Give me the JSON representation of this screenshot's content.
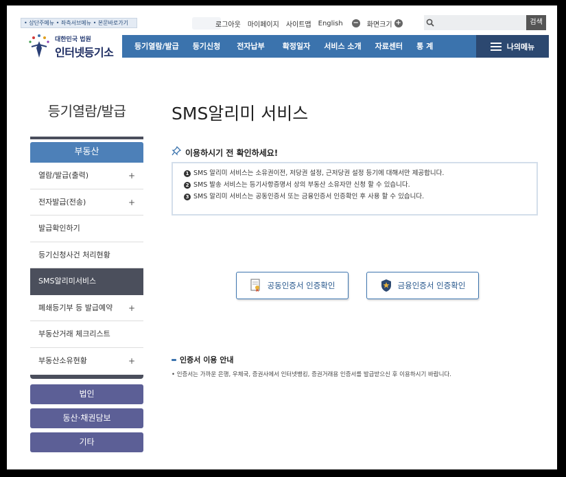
{
  "header": {
    "skip_links": "• 상단주메뉴 • 좌측서브메뉴 • 본문바로가기",
    "logo_sub": "대한민국 법원",
    "logo_main": "인터넷등기소",
    "util_links": [
      "로그아웃",
      "마이페이지",
      "사이트맵",
      "English"
    ],
    "font_size_label": "화면크기",
    "search_placeholder": "",
    "search_button": "검색"
  },
  "gnb": {
    "items": [
      "등기열람/발급",
      "등기신청",
      "전자납부",
      "확정일자",
      "서비스 소개",
      "자료센터",
      "통 계"
    ],
    "my_menu": "나의메뉴"
  },
  "lnb": {
    "title": "등기열람/발급",
    "category": "부동산",
    "items": [
      {
        "label": "열람/발급(출력)",
        "expandable": "+"
      },
      {
        "label": "전자발급(전송)",
        "expandable": "+"
      },
      {
        "label": "발급확인하기",
        "expandable": ""
      },
      {
        "label": "등기신청사건 처리현황",
        "expandable": ""
      },
      {
        "label": "SMS알리미서비스",
        "expandable": ""
      },
      {
        "label": "폐쇄등기부 등 발급예약",
        "expandable": "+"
      },
      {
        "label": "부동산거래 체크리스트",
        "expandable": ""
      },
      {
        "label": "부동산소유현황",
        "expandable": "+"
      }
    ],
    "bottom_buttons": [
      "법인",
      "동산·채권담보",
      "기타"
    ]
  },
  "main": {
    "title": "SMS알리미 서비스",
    "notice_heading": "이용하시기 전 확인하세요!",
    "notices": [
      {
        "num": "1",
        "text": "SMS 알리미 서비스는 소유권이전, 저당권 설정, 근저당권 설정 등기에 대해서만 제공합니다."
      },
      {
        "num": "2",
        "text": "SMS 발송 서비스는 등기사항증명서 상의 부동산 소유자만 신청 할 수 있습니다."
      },
      {
        "num": "3",
        "text": "SMS 알리미 서비스는 공동인증서 또는 금융인증서 인증확인 후 사용 할 수 있습니다."
      }
    ],
    "cert_buttons": {
      "joint": "공동인증서 인증확인",
      "financial": "금융인증서 인증확인"
    },
    "guide_heading": "인증서 이용 안내",
    "guide_text": "• 인증서는 가까운 은행, 우체국, 증권사에서 인터넷뱅킹, 증권거래용 인증서를 발급받으신 후 이용하시기 바랍니다."
  },
  "colors": {
    "nav": "#3b73ad",
    "nav_dark": "#2c4870",
    "lnb_active": "#4b4f5c",
    "lnb_button": "#5c5f96"
  }
}
